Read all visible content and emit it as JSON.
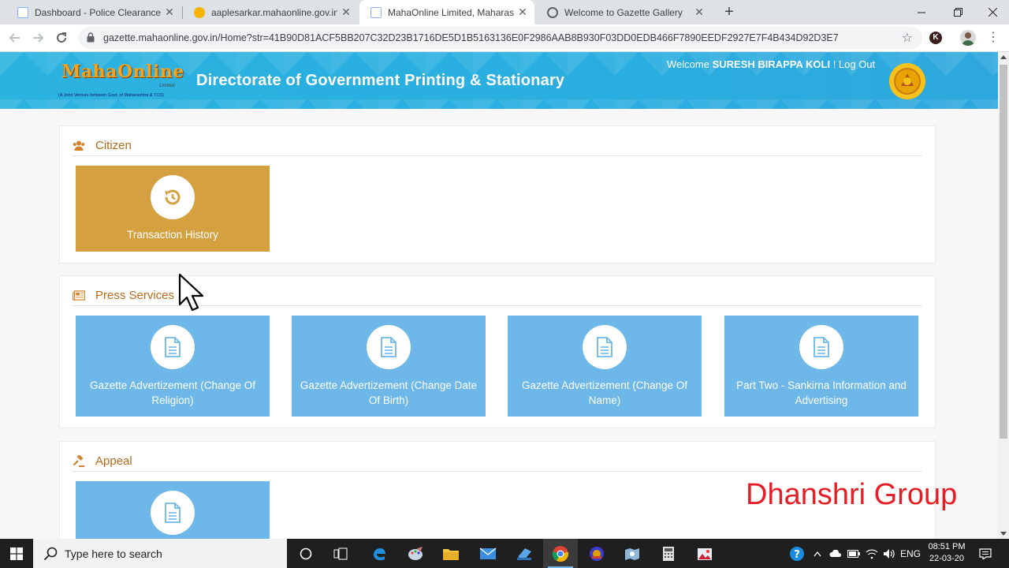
{
  "browser": {
    "tabs": [
      {
        "title": "Dashboard - Police Clearance Ce",
        "active": false
      },
      {
        "title": "aaplesarkar.mahaonline.gov.in",
        "active": false
      },
      {
        "title": "MahaOnline Limited, Maharashtr",
        "active": true
      },
      {
        "title": "Welcome to Gazette Gallery",
        "active": false
      }
    ],
    "url": "gazette.mahaonline.gov.in/Home?str=41B90D81ACF5BB207C32D23B1716DE5D1B5163136E0F2986AAB8B930F03DD0EDB466F7890EEDF2927E7F4B434D92D3E7",
    "profile_letter": "K"
  },
  "header": {
    "logo_text": "MahaOnline",
    "logo_ltd": "Limited",
    "logo_tagline": "(A Joint Venture between Govt. of Maharashtra & TCS)",
    "title": "Directorate of Government Printing & Stationary",
    "welcome_prefix": "Welcome ",
    "user_name": "SURESH BIRAPPA KOLI",
    "logout_label": " ! Log Out"
  },
  "sections": {
    "citizen": {
      "title": "Citizen",
      "tiles": [
        {
          "label": "Transaction History",
          "icon": "history-icon"
        }
      ]
    },
    "press": {
      "title": "Press Services",
      "tiles": [
        {
          "label": "Gazette Advertizement (Change Of Religion)",
          "icon": "document-icon"
        },
        {
          "label": "Gazette Advertizement (Change Date Of Birth)",
          "icon": "document-icon"
        },
        {
          "label": "Gazette Advertizement (Change Of Name)",
          "icon": "document-icon"
        },
        {
          "label": "Part Two - Sankirna Information and Advertising",
          "icon": "document-icon"
        }
      ]
    },
    "appeal": {
      "title": "Appeal",
      "tiles": [
        {
          "label": "",
          "icon": "document-icon"
        }
      ]
    }
  },
  "watermark": "Dhanshri Group",
  "taskbar": {
    "search_placeholder": "Type here to search",
    "language": "ENG",
    "time": "08:51 PM",
    "date": "22-03-20"
  },
  "colors": {
    "header_blue": "#2bb3e0",
    "tile_gold": "#d4a040",
    "tile_blue": "#6db8e9",
    "section_title": "#b36c1d",
    "watermark": "#e51e25"
  }
}
